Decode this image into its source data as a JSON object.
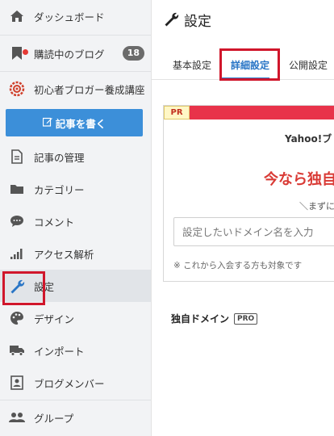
{
  "sidebar": {
    "items": [
      {
        "label": "ダッシュボード",
        "icon": "home-icon"
      },
      {
        "label": "購読中のブログ",
        "icon": "bookmark-icon",
        "badge": "18"
      },
      {
        "label": "初心者ブロガー養成講座",
        "icon": "spiral-gear-icon"
      },
      {
        "label": "記事の管理",
        "icon": "document-icon"
      },
      {
        "label": "カテゴリー",
        "icon": "folder-icon"
      },
      {
        "label": "コメント",
        "icon": "speech-bubble-icon"
      },
      {
        "label": "アクセス解析",
        "icon": "signal-bars-icon"
      },
      {
        "label": "設定",
        "icon": "wrench-icon"
      },
      {
        "label": "デザイン",
        "icon": "palette-icon"
      },
      {
        "label": "インポート",
        "icon": "truck-icon"
      },
      {
        "label": "ブログメンバー",
        "icon": "id-card-icon"
      },
      {
        "label": "グループ",
        "icon": "group-icon"
      }
    ],
    "write_button": "記事を書く"
  },
  "main": {
    "title": "設定",
    "tabs": [
      {
        "label": "基本設定"
      },
      {
        "label": "詳細設定"
      },
      {
        "label": "公開設定"
      }
    ],
    "pr": {
      "label": "PR",
      "yahoo_text": "Yahoo!ブ",
      "promo_text": "今なら独自",
      "first_text": "＼まずに",
      "input_placeholder": "設定したいドメイン名を入力",
      "note": "※ これから入会する方も対象です"
    },
    "domain": {
      "label": "独自ドメイン",
      "badge": "PRO"
    }
  },
  "colors": {
    "accent_blue": "#3c8fd9",
    "tab_active": "#2a76c6",
    "highlight_red": "#d0162b",
    "pr_bar": "#e8334a",
    "promo_red": "#d93a35"
  }
}
